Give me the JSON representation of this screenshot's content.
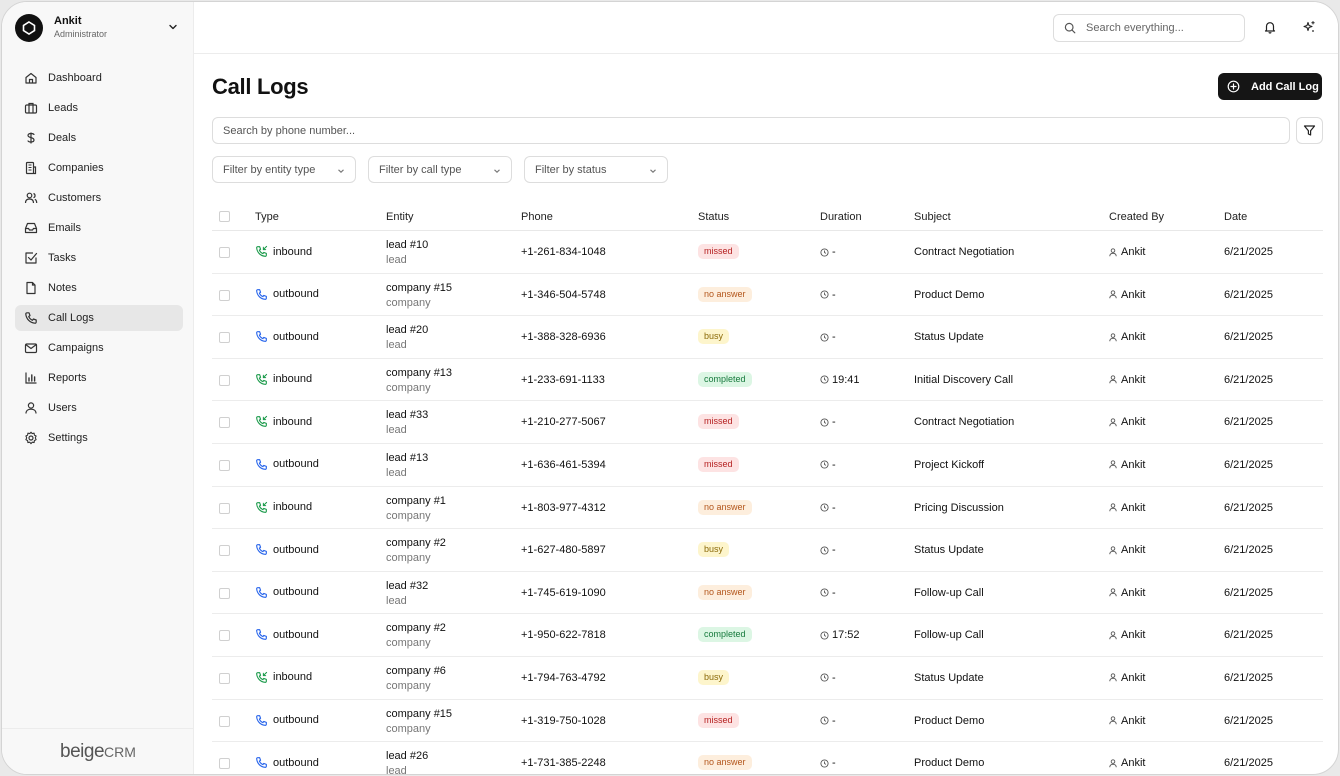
{
  "user": {
    "name": "Ankit",
    "role": "Administrator"
  },
  "nav": [
    {
      "label": "Dashboard",
      "icon": "home-icon"
    },
    {
      "label": "Leads",
      "icon": "briefcase-icon"
    },
    {
      "label": "Deals",
      "icon": "dollar-icon"
    },
    {
      "label": "Companies",
      "icon": "building-icon"
    },
    {
      "label": "Customers",
      "icon": "users-icon"
    },
    {
      "label": "Emails",
      "icon": "inbox-icon"
    },
    {
      "label": "Tasks",
      "icon": "check-square-icon"
    },
    {
      "label": "Notes",
      "icon": "file-icon"
    },
    {
      "label": "Call Logs",
      "icon": "phone-icon",
      "active": true
    },
    {
      "label": "Campaigns",
      "icon": "mail-icon"
    },
    {
      "label": "Reports",
      "icon": "bar-chart-icon"
    },
    {
      "label": "Users",
      "icon": "user-icon"
    },
    {
      "label": "Settings",
      "icon": "gear-icon"
    }
  ],
  "brand": {
    "main": "beige",
    "suffix": "CRM"
  },
  "topbar": {
    "search_placeholder": "Search everything..."
  },
  "page": {
    "title": "Call Logs",
    "add_button": "Add Call Log",
    "phone_search_placeholder": "Search by phone number...",
    "filters": [
      "Filter by entity type",
      "Filter by call type",
      "Filter by status"
    ]
  },
  "table": {
    "headers": [
      "Type",
      "Entity",
      "Phone",
      "Status",
      "Duration",
      "Subject",
      "Created By",
      "Date"
    ],
    "rows": [
      {
        "type": "inbound",
        "entity": "lead #10",
        "entity_type": "lead",
        "phone": "+1-261-834-1048",
        "status": "missed",
        "duration": "-",
        "subject": "Contract Negotiation",
        "created_by": "Ankit",
        "date": "6/21/2025"
      },
      {
        "type": "outbound",
        "entity": "company #15",
        "entity_type": "company",
        "phone": "+1-346-504-5748",
        "status": "no answer",
        "duration": "-",
        "subject": "Product Demo",
        "created_by": "Ankit",
        "date": "6/21/2025"
      },
      {
        "type": "outbound",
        "entity": "lead #20",
        "entity_type": "lead",
        "phone": "+1-388-328-6936",
        "status": "busy",
        "duration": "-",
        "subject": "Status Update",
        "created_by": "Ankit",
        "date": "6/21/2025"
      },
      {
        "type": "inbound",
        "entity": "company #13",
        "entity_type": "company",
        "phone": "+1-233-691-1133",
        "status": "completed",
        "duration": "19:41",
        "subject": "Initial Discovery Call",
        "created_by": "Ankit",
        "date": "6/21/2025"
      },
      {
        "type": "inbound",
        "entity": "lead #33",
        "entity_type": "lead",
        "phone": "+1-210-277-5067",
        "status": "missed",
        "duration": "-",
        "subject": "Contract Negotiation",
        "created_by": "Ankit",
        "date": "6/21/2025"
      },
      {
        "type": "outbound",
        "entity": "lead #13",
        "entity_type": "lead",
        "phone": "+1-636-461-5394",
        "status": "missed",
        "duration": "-",
        "subject": "Project Kickoff",
        "created_by": "Ankit",
        "date": "6/21/2025"
      },
      {
        "type": "inbound",
        "entity": "company #1",
        "entity_type": "company",
        "phone": "+1-803-977-4312",
        "status": "no answer",
        "duration": "-",
        "subject": "Pricing Discussion",
        "created_by": "Ankit",
        "date": "6/21/2025"
      },
      {
        "type": "outbound",
        "entity": "company #2",
        "entity_type": "company",
        "phone": "+1-627-480-5897",
        "status": "busy",
        "duration": "-",
        "subject": "Status Update",
        "created_by": "Ankit",
        "date": "6/21/2025"
      },
      {
        "type": "outbound",
        "entity": "lead #32",
        "entity_type": "lead",
        "phone": "+1-745-619-1090",
        "status": "no answer",
        "duration": "-",
        "subject": "Follow-up Call",
        "created_by": "Ankit",
        "date": "6/21/2025"
      },
      {
        "type": "outbound",
        "entity": "company #2",
        "entity_type": "company",
        "phone": "+1-950-622-7818",
        "status": "completed",
        "duration": "17:52",
        "subject": "Follow-up Call",
        "created_by": "Ankit",
        "date": "6/21/2025"
      },
      {
        "type": "inbound",
        "entity": "company #6",
        "entity_type": "company",
        "phone": "+1-794-763-4792",
        "status": "busy",
        "duration": "-",
        "subject": "Status Update",
        "created_by": "Ankit",
        "date": "6/21/2025"
      },
      {
        "type": "outbound",
        "entity": "company #15",
        "entity_type": "company",
        "phone": "+1-319-750-1028",
        "status": "missed",
        "duration": "-",
        "subject": "Product Demo",
        "created_by": "Ankit",
        "date": "6/21/2025"
      },
      {
        "type": "outbound",
        "entity": "lead #26",
        "entity_type": "lead",
        "phone": "+1-731-385-2248",
        "status": "no answer",
        "duration": "-",
        "subject": "Product Demo",
        "created_by": "Ankit",
        "date": "6/21/2025"
      }
    ]
  },
  "colors": {
    "inbound": "#1a9a4a",
    "outbound": "#2563eb",
    "primary": "#151515"
  }
}
